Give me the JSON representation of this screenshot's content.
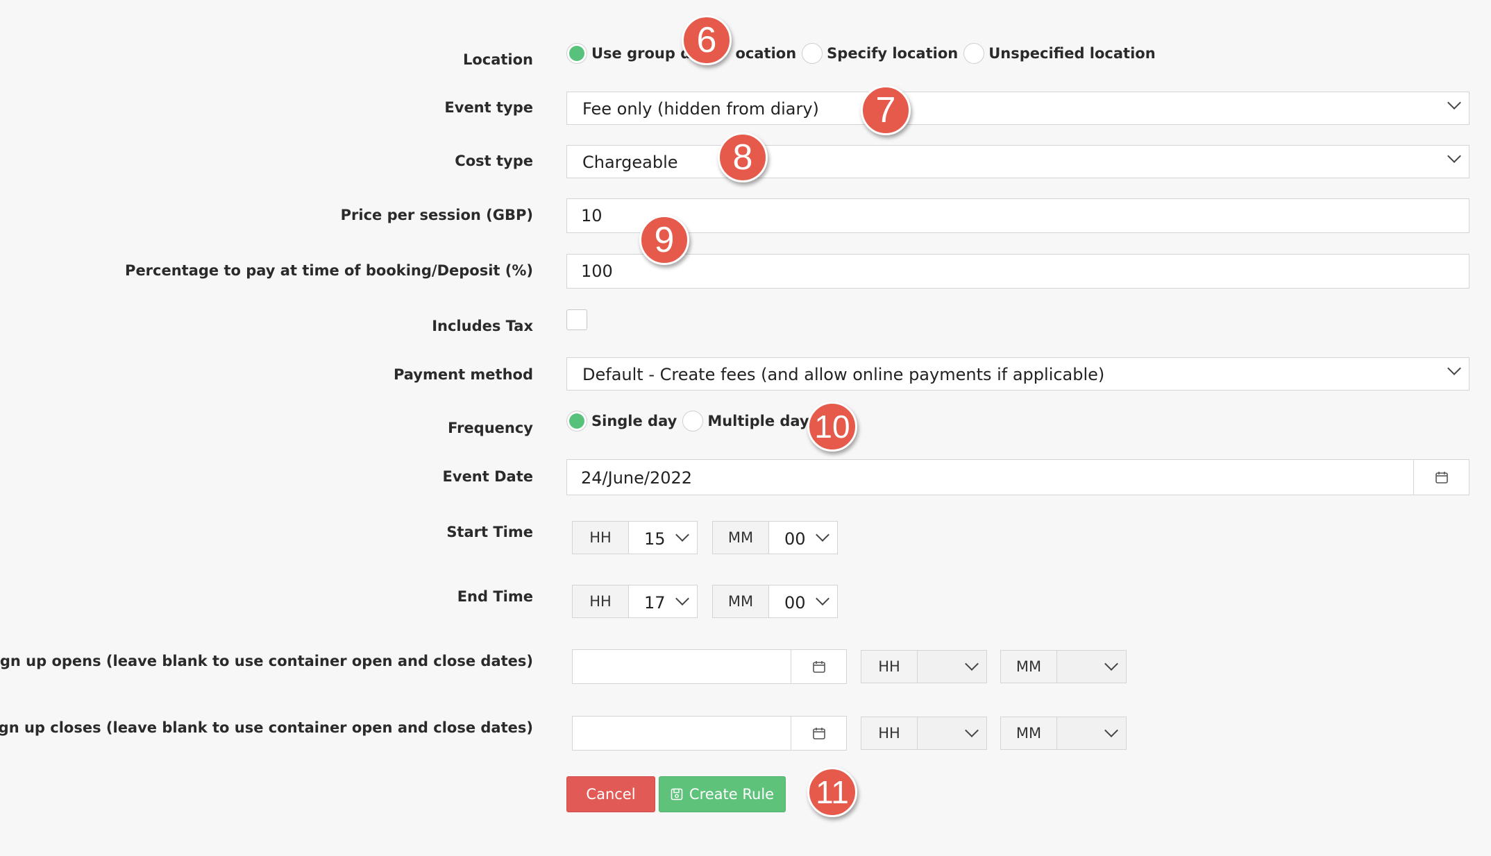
{
  "fields": {
    "location_label": "Location",
    "event_type_label": "Event type",
    "cost_type_label": "Cost type",
    "price_label": "Price per session (GBP)",
    "percentage_label": "Percentage to pay at time of booking/Deposit (%)",
    "includes_tax_label": "Includes Tax",
    "payment_method_label": "Payment method",
    "frequency_label": "Frequency",
    "event_date_label": "Event Date",
    "start_time_label": "Start Time",
    "end_time_label": "End Time",
    "signup_opens_label": "Sign up opens (leave blank to use container open and close dates)",
    "signup_closes_label": "Sign up closes (leave blank to use container open and close dates)"
  },
  "location": {
    "options": [
      "Use group default location",
      "Specify location",
      "Unspecified location"
    ],
    "visible_text": [
      "Use group de",
      "ocation",
      "Specify location",
      "Unspecified location"
    ],
    "selected": "Use group default location"
  },
  "event_type": {
    "value": "Fee only (hidden from diary)"
  },
  "cost_type": {
    "value": "Chargeable"
  },
  "price": {
    "value": "10"
  },
  "percentage": {
    "value": "100"
  },
  "includes_tax": {
    "checked": false
  },
  "payment_method": {
    "value": "Default - Create fees (and allow online payments if applicable)"
  },
  "frequency": {
    "options": [
      "Single day",
      "Multiple days"
    ],
    "selected": "Single day"
  },
  "event_date": {
    "value": "24/June/2022"
  },
  "start_time": {
    "hh_label": "HH",
    "hh": "15",
    "mm_label": "MM",
    "mm": "00"
  },
  "end_time": {
    "hh_label": "HH",
    "hh": "17",
    "mm_label": "MM",
    "mm": "00"
  },
  "signup_opens": {
    "date": "",
    "hh_label": "HH",
    "hh": "",
    "mm_label": "MM",
    "mm": ""
  },
  "signup_closes": {
    "date": "",
    "hh_label": "HH",
    "hh": "",
    "mm_label": "MM",
    "mm": ""
  },
  "buttons": {
    "cancel": "Cancel",
    "create": "Create Rule"
  },
  "badges": [
    "6",
    "7",
    "8",
    "9",
    "10",
    "11"
  ],
  "colors": {
    "accent_green": "#5ec27b",
    "cancel_red": "#e25a55",
    "badge_red": "#e65a4c"
  },
  "icons": [
    "calendar-icon",
    "save-icon",
    "chevron-down-icon"
  ]
}
